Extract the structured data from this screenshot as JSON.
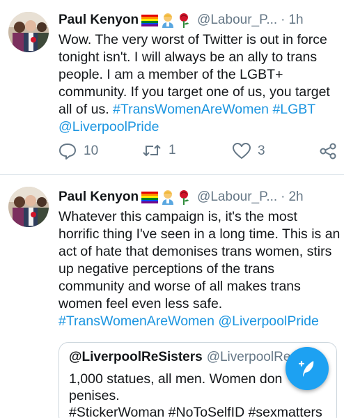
{
  "colors": {
    "accent": "#1da1f2",
    "link": "#1b95e0",
    "muted": "#657786",
    "text": "#14171a"
  },
  "tweets": [
    {
      "author": "Paul Kenyon",
      "handle": "@Labour_P...",
      "separator": "·",
      "time": "1h",
      "icons": [
        "rainbow-flag-icon",
        "man-emoji-icon",
        "red-rose-icon"
      ],
      "lines": [
        "Wow. The very worst of Twitter is out in force",
        "tonight isn't. I will always be an ally to trans",
        "people. I am a member of the LGBT+",
        "community. If you target one of us, you target"
      ],
      "line5_text": "all of us. ",
      "line5_tags": "#TransWomenAreWomen #LGBT",
      "line6_tags": "@LiverpoolPride",
      "replies": "10",
      "retweets": "1",
      "likes": "3"
    },
    {
      "author": "Paul Kenyon",
      "handle": "@Labour_P...",
      "separator": "·",
      "time": "2h",
      "icons": [
        "rainbow-flag-icon",
        "man-emoji-icon",
        "red-rose-icon"
      ],
      "lines": [
        "Whatever this campaign is, it's the most",
        "horrific thing I've seen in a long time. This is an",
        "act of hate that demonises trans women, stirs",
        "up negative perceptions of the trans",
        "community and worse of all makes trans",
        "women feel even less safe."
      ],
      "tags": "#TransWomenAreWomen @LiverpoolPride",
      "quote": {
        "author": "@LiverpoolReSisters",
        "handle": "@LiverpoolRe",
        "lines": [
          "1,000 statues, all men. Women don",
          "penises.",
          "#StickerWoman #NoToSelfID #sexmatters"
        ]
      }
    }
  ],
  "fab": {
    "icon": "compose-tweet-icon"
  }
}
